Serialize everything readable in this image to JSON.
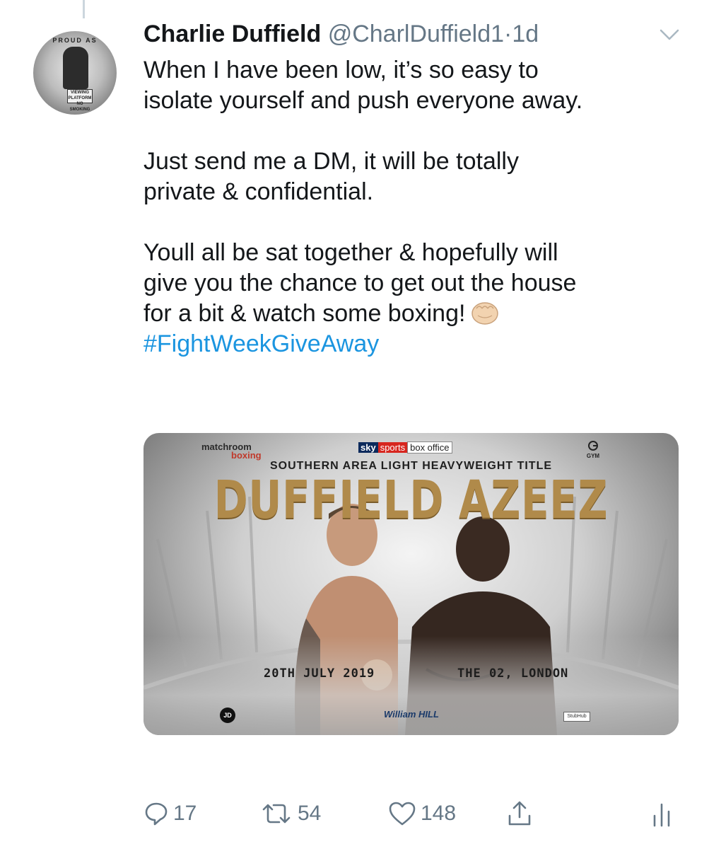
{
  "tweet": {
    "author_name": "Charlie Duffield",
    "handle": "@CharlDuffield1",
    "separator": "·",
    "time": "1d",
    "avatar_text": "PROUD AS",
    "avatar_sign": "VIEWING PLATFORM NO SMOKING",
    "lines": {
      "l1": "When I have been low, it’s so easy to",
      "l2": "isolate yourself and push everyone away.",
      "l3": "Just send me a DM, it will be totally",
      "l4": "private & confidential.",
      "l5": "Youll all be sat together & hopefully will",
      "l6": "give you the chance to get out the house",
      "l7": "for a bit & watch some boxing!"
    },
    "hashtag": "#FightWeekGiveAway",
    "emoji": "fist-bump-emoji"
  },
  "poster": {
    "promoter": "matchroom",
    "promoter_sub": "boxing",
    "broadcaster_sky": "sky",
    "broadcaster_sports": "sports",
    "broadcaster_box": "box office",
    "gym_logo": "GYM",
    "title": "SOUTHERN AREA LIGHT HEAVYWEIGHT TITLE",
    "fighter_names": "DUFFIELD AZEEZ",
    "date": "20TH JULY 2019",
    "venue": "THE 02, LONDON",
    "jd_logo": "JD",
    "sponsor": "William HILL",
    "ticket_partner": "StubHub"
  },
  "actions": {
    "reply_count": "17",
    "retweet_count": "54",
    "like_count": "148"
  },
  "icons": {
    "reply": "reply-icon",
    "retweet": "retweet-icon",
    "like": "heart-icon",
    "share": "share-icon",
    "analytics": "analytics-icon",
    "more": "chevron-down-icon"
  },
  "colors": {
    "text": "#14171a",
    "muted": "#657786",
    "link": "#1b95e0",
    "poster_gold": "#b08a4a"
  }
}
